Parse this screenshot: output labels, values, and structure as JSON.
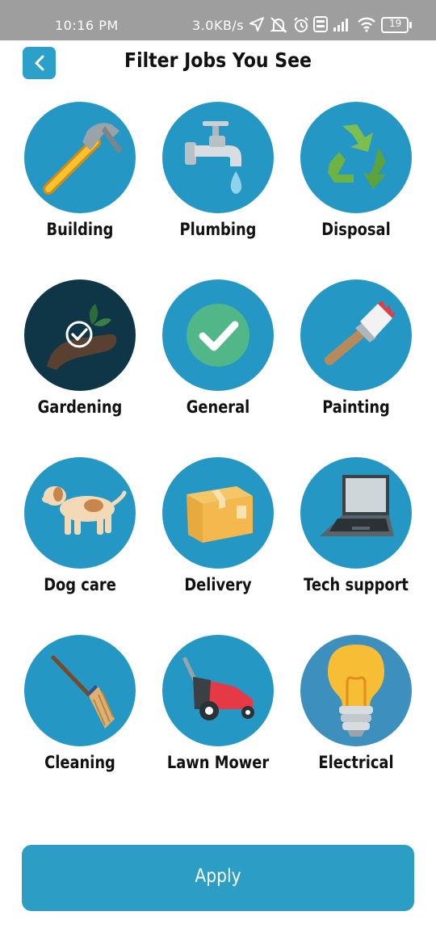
{
  "status_bar": {
    "time": "10:16 PM",
    "network_speed": "3.0KB/s",
    "icons": [
      "location-arrow-icon",
      "muted-bell-icon",
      "alarm-icon",
      "volte-icon",
      "signal-icon",
      "wifi-icon",
      "battery-icon"
    ],
    "battery_level": "19"
  },
  "header": {
    "back_icon": "chevron-left-icon",
    "title": "Filter Jobs You See"
  },
  "categories": [
    {
      "label": "Building",
      "icon": "hammer-icon",
      "selected": false
    },
    {
      "label": "Plumbing",
      "icon": "faucet-icon",
      "selected": false
    },
    {
      "label": "Disposal",
      "icon": "recycle-icon",
      "selected": false
    },
    {
      "label": "Gardening",
      "icon": "hand-plant-icon",
      "selected": true
    },
    {
      "label": "General",
      "icon": "checkmark-icon",
      "selected": false
    },
    {
      "label": "Painting",
      "icon": "paintbrush-icon",
      "selected": false
    },
    {
      "label": "Dog care",
      "icon": "dog-icon",
      "selected": false
    },
    {
      "label": "Delivery",
      "icon": "package-icon",
      "selected": false
    },
    {
      "label": "Tech support",
      "icon": "laptop-icon",
      "selected": false
    },
    {
      "label": "Cleaning",
      "icon": "broom-icon",
      "selected": false
    },
    {
      "label": "Lawn Mower",
      "icon": "lawn-mower-icon",
      "selected": false
    },
    {
      "label": "Electrical",
      "icon": "light-bulb-icon",
      "selected": false
    }
  ],
  "apply_button": {
    "label": "Apply"
  },
  "colors": {
    "accent": "#2ba0c9",
    "circle": "#2497c4",
    "selected_circle": "#0e3646",
    "status_bar": "#9e9e9e"
  }
}
